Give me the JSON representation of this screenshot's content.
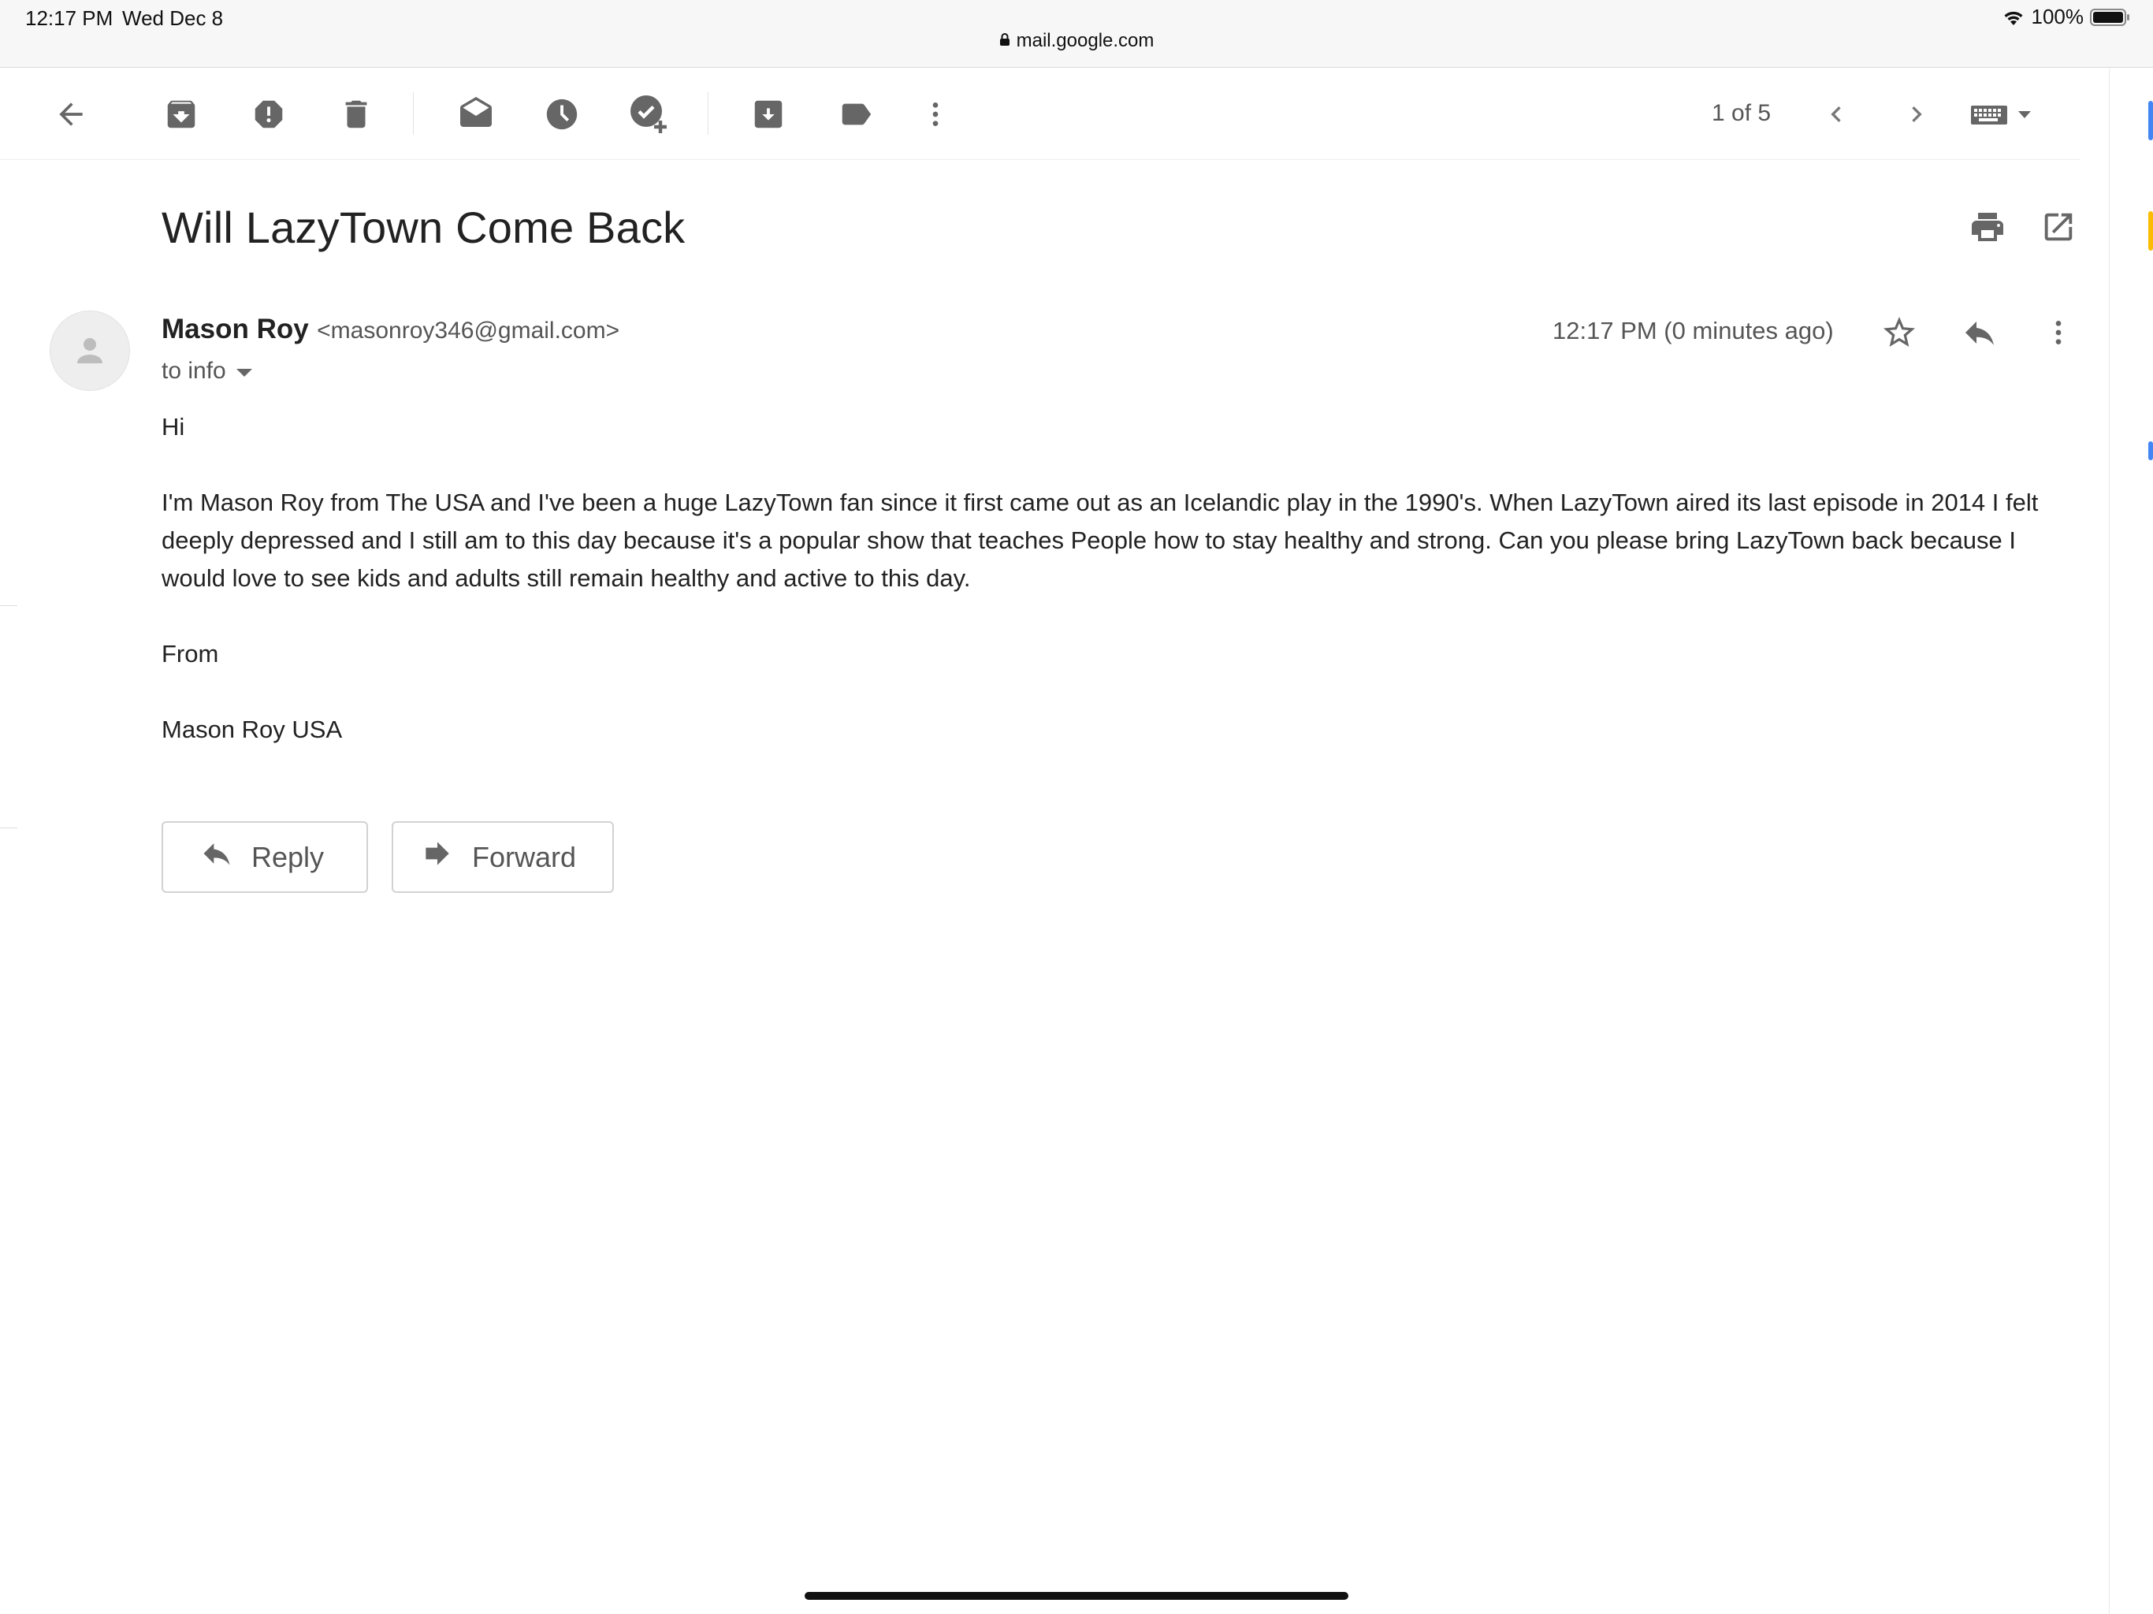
{
  "status_bar": {
    "time": "12:17 PM",
    "date": "Wed Dec 8",
    "battery": "100%",
    "url": "mail.google.com"
  },
  "toolbar": {
    "page_count": "1 of 5",
    "icons": [
      "back-arrow-icon",
      "archive-icon",
      "report-spam-icon",
      "delete-icon",
      "mark-unread-icon",
      "snooze-icon",
      "add-to-tasks-icon",
      "move-to-icon",
      "label-icon",
      "more-vert-icon",
      "older-chevron-icon",
      "newer-chevron-icon",
      "keyboard-icon"
    ]
  },
  "email": {
    "subject": "Will LazyTown Come Back",
    "sender_name": "Mason Roy",
    "sender_email": "<masonroy346@gmail.com>",
    "recipient": "to info",
    "timestamp": "12:17 PM (0 minutes ago)",
    "body": [
      "Hi",
      "I'm Mason Roy from The USA  and I've been a huge LazyTown fan since it first came out as an Icelandic play in the 1990's. When LazyTown aired its last episode in 2014 I felt deeply depressed and I still am to this day because it's a popular show that teaches People how to stay healthy and strong. Can you please bring LazyTown back because I would love to see kids and adults still remain healthy and active to this day.",
      "From",
      "Mason Roy USA"
    ]
  },
  "actions": {
    "reply_label": "Reply",
    "forward_label": "Forward"
  },
  "colors": {
    "icon_gray": "#666666",
    "text_dark": "#222222",
    "text_muted": "#555555",
    "status_bar_bg": "#f7f7f7"
  }
}
